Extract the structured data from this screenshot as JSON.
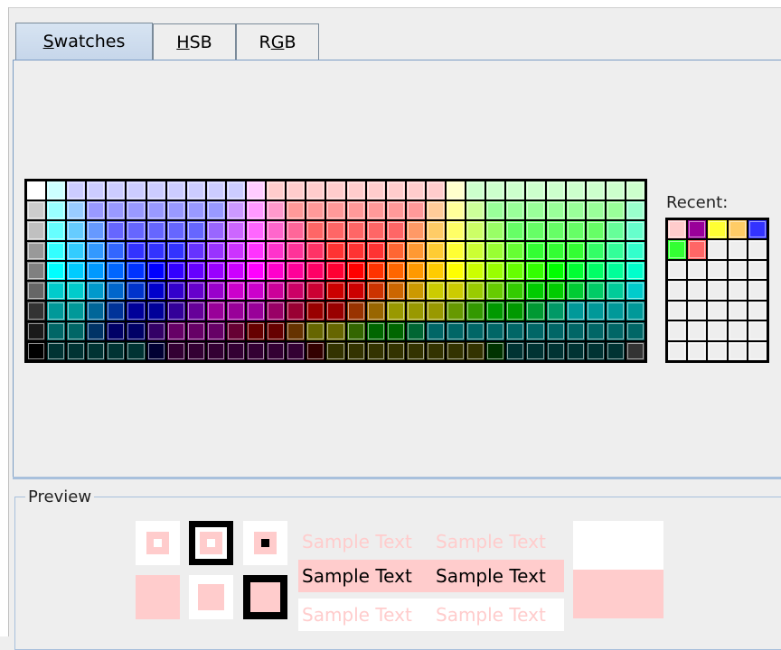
{
  "tabs": [
    {
      "label_prefix": "",
      "mnemonic": "S",
      "label_rest": "watches",
      "active": true
    },
    {
      "label_prefix": "",
      "mnemonic": "H",
      "label_rest": "SB",
      "active": false
    },
    {
      "label_prefix": "R",
      "mnemonic": "G",
      "label_rest": "B",
      "active": false
    }
  ],
  "swatches": {
    "rows": [
      [
        "#ffffff",
        "#ccffff",
        "#ccccff",
        "#ccccff",
        "#ccccff",
        "#ccccff",
        "#ccccff",
        "#ccccff",
        "#ccccff",
        "#ccccff",
        "#ccccff",
        "#ffccff",
        "#ffcccc",
        "#ffcccc",
        "#ffcccc",
        "#ffcccc",
        "#ffcccc",
        "#ffcccc",
        "#ffcccc",
        "#ffcccc",
        "#ffcccc",
        "#ffffcc",
        "#ccffcc",
        "#ccffcc",
        "#ccffcc",
        "#ccffcc",
        "#ccffcc",
        "#ccffcc",
        "#ccffcc",
        "#ccffcc",
        "#ccffcc"
      ],
      [
        "#cccccc",
        "#99ffff",
        "#99ccff",
        "#9999ff",
        "#9999ff",
        "#9999ff",
        "#9999ff",
        "#9999ff",
        "#9999ff",
        "#9999ff",
        "#cc99ff",
        "#ff99ff",
        "#ff99cc",
        "#ff9999",
        "#ff9999",
        "#ff9999",
        "#ff9999",
        "#ff9999",
        "#ff9999",
        "#ff9999",
        "#ffcc99",
        "#ffff99",
        "#ccff99",
        "#99ff99",
        "#99ff99",
        "#99ff99",
        "#99ff99",
        "#99ff99",
        "#99ff99",
        "#99ff99",
        "#99ffcc"
      ],
      [
        "#c0c0c0",
        "#66ffff",
        "#66ccff",
        "#6699ff",
        "#6666ff",
        "#6666ff",
        "#6666ff",
        "#6666ff",
        "#6666ff",
        "#9966ff",
        "#cc66ff",
        "#ff66ff",
        "#ff66cc",
        "#ff6699",
        "#ff6666",
        "#ff6666",
        "#ff6666",
        "#ff6666",
        "#ff6666",
        "#ff9966",
        "#ffcc66",
        "#ffff66",
        "#ccff66",
        "#99ff66",
        "#66ff66",
        "#66ff66",
        "#66ff66",
        "#66ff66",
        "#66ff66",
        "#66ff99",
        "#66ffcc"
      ],
      [
        "#999999",
        "#33ffff",
        "#33ccff",
        "#3399ff",
        "#3366ff",
        "#3333ff",
        "#3333ff",
        "#3333ff",
        "#6633ff",
        "#9933ff",
        "#cc33ff",
        "#ff33ff",
        "#ff33cc",
        "#ff3399",
        "#ff3366",
        "#ff3333",
        "#ff3333",
        "#ff3333",
        "#ff6633",
        "#ff9933",
        "#ffcc33",
        "#ffff33",
        "#ccff33",
        "#99ff33",
        "#66ff33",
        "#33ff33",
        "#33ff33",
        "#33ff33",
        "#33ff66",
        "#33ff99",
        "#33ffcc"
      ],
      [
        "#808080",
        "#00ffff",
        "#00ccff",
        "#0099ff",
        "#0066ff",
        "#0033ff",
        "#0000ff",
        "#3300ff",
        "#6600ff",
        "#9900ff",
        "#cc00ff",
        "#ff00ff",
        "#ff00cc",
        "#ff0099",
        "#ff0066",
        "#ff0033",
        "#ff0000",
        "#ff3300",
        "#ff6600",
        "#ff9900",
        "#ffcc00",
        "#ffff00",
        "#ccff00",
        "#99ff00",
        "#66ff00",
        "#33ff00",
        "#00ff00",
        "#00ff33",
        "#00ff66",
        "#00ff99",
        "#00ffcc"
      ],
      [
        "#666666",
        "#00cccc",
        "#00cccc",
        "#0099cc",
        "#0066cc",
        "#0033cc",
        "#0000cc",
        "#3300cc",
        "#6600cc",
        "#9900cc",
        "#cc00cc",
        "#cc00cc",
        "#cc0099",
        "#cc0066",
        "#cc0033",
        "#cc0000",
        "#cc0000",
        "#cc3300",
        "#cc6600",
        "#cc9900",
        "#cccc00",
        "#cccc00",
        "#99cc00",
        "#66cc00",
        "#33cc00",
        "#00cc00",
        "#00cc00",
        "#00cc33",
        "#00cc66",
        "#00cc99",
        "#00cccc"
      ],
      [
        "#333333",
        "#009999",
        "#009999",
        "#006699",
        "#003399",
        "#000099",
        "#000099",
        "#330099",
        "#660099",
        "#990099",
        "#990099",
        "#990099",
        "#990066",
        "#990033",
        "#990000",
        "#990000",
        "#993300",
        "#996600",
        "#999900",
        "#999900",
        "#999900",
        "#669900",
        "#339900",
        "#009900",
        "#009900",
        "#009933",
        "#009966",
        "#009999",
        "#009999",
        "#009999",
        "#009999"
      ],
      [
        "#1a1a1a",
        "#006666",
        "#006666",
        "#003366",
        "#000066",
        "#000066",
        "#330066",
        "#660066",
        "#660066",
        "#660066",
        "#660033",
        "#660000",
        "#660000",
        "#663300",
        "#666600",
        "#666600",
        "#336600",
        "#006600",
        "#006600",
        "#006633",
        "#006666",
        "#006666",
        "#006666",
        "#006666",
        "#006666",
        "#006666",
        "#006666",
        "#006666",
        "#006666",
        "#006666",
        "#006666"
      ],
      [
        "#000000",
        "#003333",
        "#003333",
        "#003333",
        "#003333",
        "#003333",
        "#000033",
        "#330033",
        "#330033",
        "#330033",
        "#330033",
        "#330033",
        "#330033",
        "#330033",
        "#330000",
        "#333300",
        "#333300",
        "#333300",
        "#333300",
        "#333300",
        "#333300",
        "#333300",
        "#333300",
        "#003300",
        "#003333",
        "#003333",
        "#003333",
        "#003333",
        "#003333",
        "#003333",
        "#333333"
      ]
    ]
  },
  "recent": {
    "label": "Recent:",
    "rows": [
      [
        "#ffcccc",
        "#990099",
        "#ffff33",
        "#ffcc66",
        "#3333ff"
      ],
      [
        "#33ff33",
        "#ff6666",
        "#eeeeee",
        "#eeeeee",
        "#eeeeee"
      ],
      [
        "#eeeeee",
        "#eeeeee",
        "#eeeeee",
        "#eeeeee",
        "#eeeeee"
      ],
      [
        "#eeeeee",
        "#eeeeee",
        "#eeeeee",
        "#eeeeee",
        "#eeeeee"
      ],
      [
        "#eeeeee",
        "#eeeeee",
        "#eeeeee",
        "#eeeeee",
        "#eeeeee"
      ],
      [
        "#eeeeee",
        "#eeeeee",
        "#eeeeee",
        "#eeeeee",
        "#eeeeee"
      ],
      [
        "#eeeeee",
        "#eeeeee",
        "#eeeeee",
        "#eeeeee",
        "#eeeeee"
      ]
    ]
  },
  "preview": {
    "title": "Preview",
    "selected_color": "#ffcccc",
    "sample_text": "Sample Text",
    "samples": [
      {
        "text1": "Sample Text",
        "text2": "Sample Text"
      },
      {
        "text1": "Sample Text",
        "text2": "Sample Text"
      },
      {
        "text1": "Sample Text",
        "text2": "Sample Text"
      }
    ]
  }
}
